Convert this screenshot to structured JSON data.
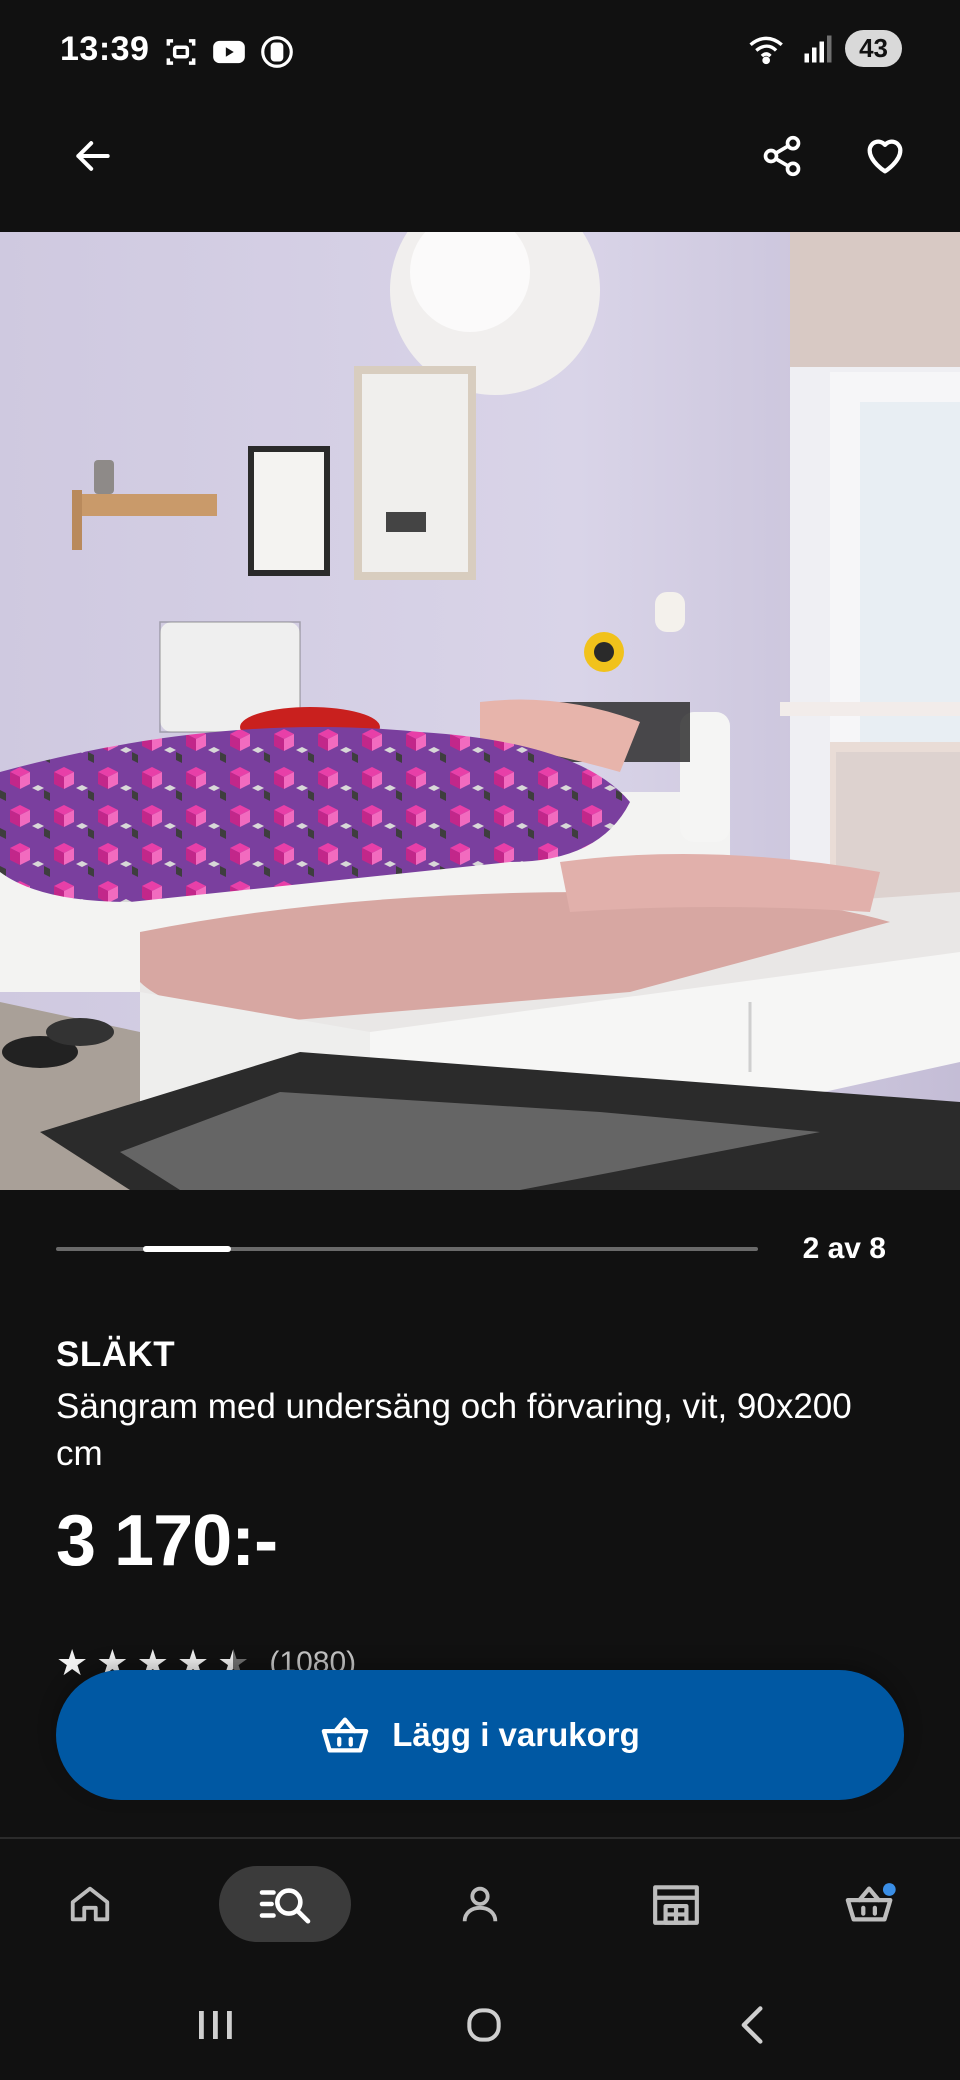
{
  "status_bar": {
    "time": "13:39",
    "network": "5",
    "battery": "43"
  },
  "app_bar": {
    "back_icon": "arrow-left-icon",
    "share_icon": "share-icon",
    "favorite_icon": "heart-outline-icon"
  },
  "gallery": {
    "counter": "2 av 8",
    "current": 2,
    "total": 8
  },
  "product": {
    "name": "SLÄKT",
    "description": "Sängram med undersäng och förvaring, vit, 90x200 cm",
    "price": "3 170:-",
    "rating_value": 4.5,
    "rating_count": "(1080)"
  },
  "cta": {
    "label": "Lägg i varukorg",
    "icon": "basket-icon"
  },
  "bottom_nav": {
    "items": [
      "home-icon",
      "search-list-icon",
      "profile-icon",
      "store-icon",
      "cart-icon"
    ],
    "active": "search-list-icon"
  },
  "colors": {
    "background": "#111111",
    "primary": "#0058a3",
    "notification_dot": "#3a8ee6"
  }
}
